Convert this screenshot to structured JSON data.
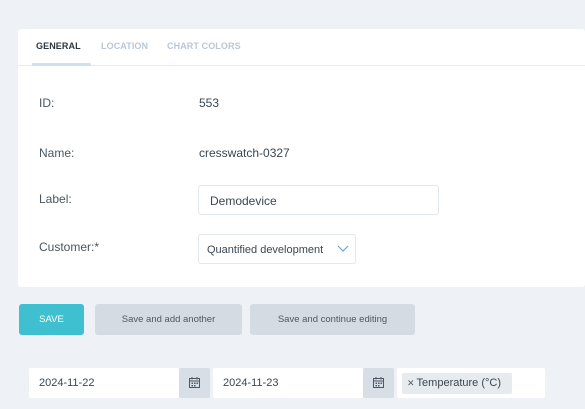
{
  "tabs": [
    {
      "label": "GENERAL",
      "active": true
    },
    {
      "label": "LOCATION",
      "active": false
    },
    {
      "label": "CHART COLORS",
      "active": false
    }
  ],
  "fields": {
    "id_label": "ID:",
    "id_value": "553",
    "name_label": "Name:",
    "name_value": "cresswatch-0327",
    "label_label": "Label:",
    "label_value": "Demodevice",
    "customer_label": "Customer:*",
    "customer_value": "Quantified development"
  },
  "buttons": {
    "save": "SAVE",
    "save_add": "Save and add another",
    "save_continue": "Save and continue editing"
  },
  "filters": {
    "date_from": "2024-11-22",
    "date_to": "2024-11-23",
    "sensor_tag": "Temperature (°C)"
  },
  "colors": {
    "accent": "#3fc0d0",
    "background": "#eef1f5",
    "button_grey": "#d5dbe2"
  },
  "icons": [
    "calendar-icon",
    "chevron-down-icon",
    "remove-tag-icon"
  ]
}
